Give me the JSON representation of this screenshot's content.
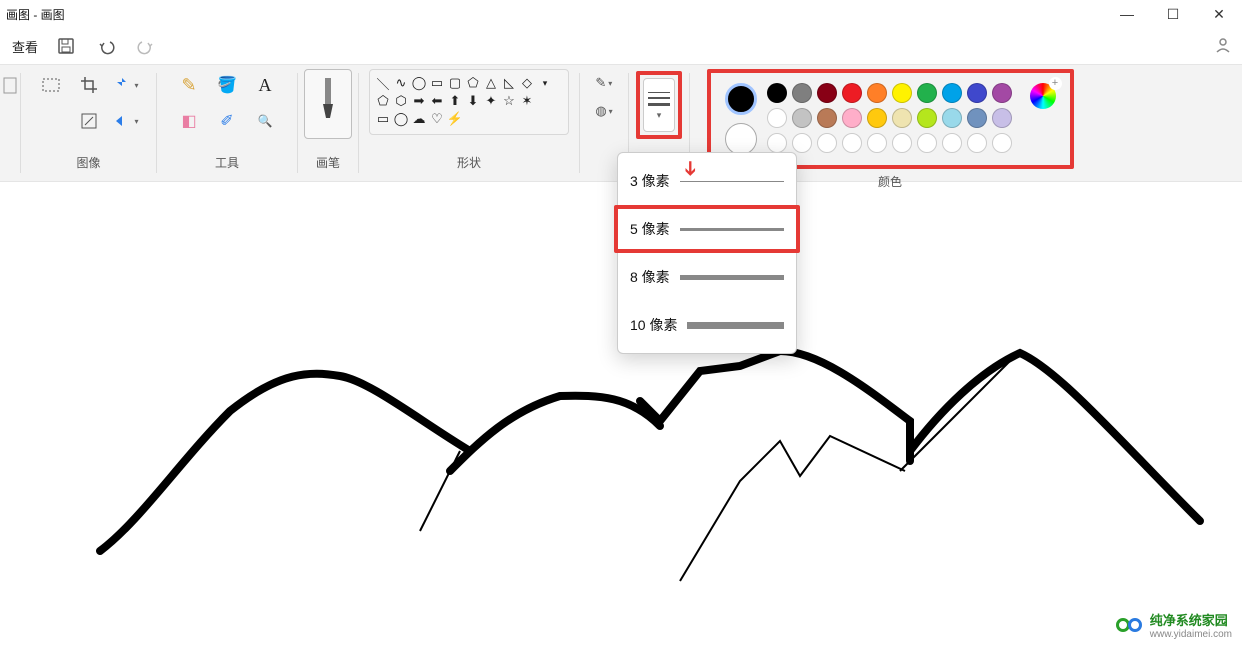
{
  "window": {
    "title": "画图 - 画图"
  },
  "winbtns": {
    "min": "—",
    "max": "☐",
    "close": "✕"
  },
  "menubar": {
    "view": "查看"
  },
  "groups": {
    "image": "图像",
    "tools": "工具",
    "brushes": "画笔",
    "shapes": "形状",
    "colors": "颜色"
  },
  "sizeMenu": {
    "items": [
      {
        "label": "3 像素"
      },
      {
        "label": "5 像素"
      },
      {
        "label": "8 像素"
      },
      {
        "label": "10 像素"
      }
    ]
  },
  "colors": {
    "row1": [
      "#000000",
      "#7f7f7f",
      "#880015",
      "#ed1c24",
      "#ff7f27",
      "#fff200",
      "#22b14c",
      "#00a2e8",
      "#3f48cc",
      "#a349a4"
    ],
    "row2": [
      "#ffffff",
      "#c3c3c3",
      "#b97a57",
      "#ffaec9",
      "#ffc90e",
      "#efe4b0",
      "#b5e61d",
      "#99d9ea",
      "#7092be",
      "#c8bfe7"
    ]
  },
  "footer": {
    "brand": "纯净系统家园",
    "url": "www.yidaimei.com"
  }
}
